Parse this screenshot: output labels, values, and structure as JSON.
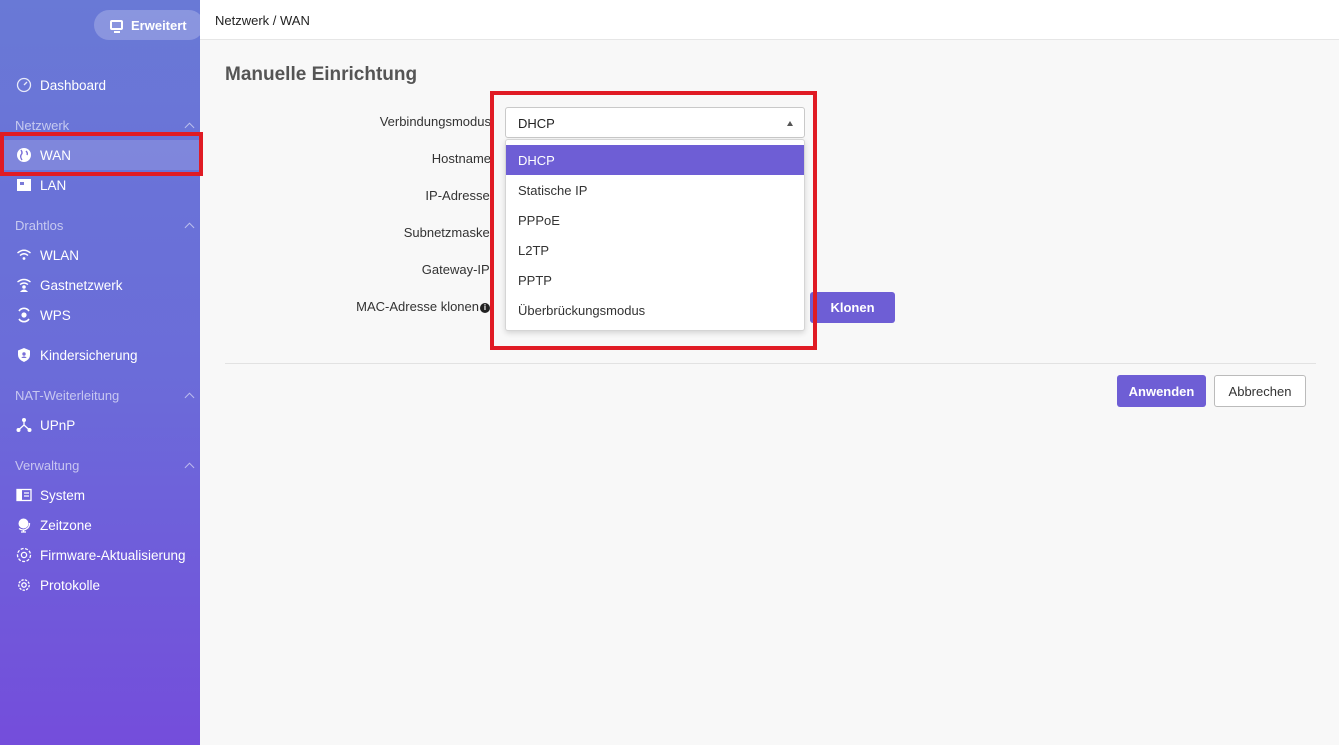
{
  "sidebar": {
    "mode_button": "Erweitert",
    "dashboard": "Dashboard",
    "sections": {
      "netzwerk": "Netzwerk",
      "drahtlos": "Drahtlos",
      "nat": "NAT-Weiterleitung",
      "verwaltung": "Verwaltung"
    },
    "items": {
      "wan": "WAN",
      "lan": "LAN",
      "wlan": "WLAN",
      "gastnetzwerk": "Gastnetzwerk",
      "wps": "WPS",
      "kindersicherung": "Kindersicherung",
      "upnp": "UPnP",
      "system": "System",
      "zeitzone": "Zeitzone",
      "firmware": "Firmware-Aktualisierung",
      "protokolle": "Protokolle"
    },
    "active_item": "WAN"
  },
  "header": {
    "breadcrumb": "Netzwerk / WAN"
  },
  "main": {
    "title": "Manuelle Einrichtung",
    "form": {
      "labels": {
        "verbindungsmodus": "Verbindungsmodus",
        "hostname": "Hostname",
        "ip": "IP-Adresse",
        "subnet": "Subnetzmaske",
        "gateway": "Gateway-IP",
        "mac": "MAC-Adresse klonen"
      },
      "required_mark": "*",
      "info_mark": "i",
      "mode_value": "DHCP",
      "mode_options": [
        "DHCP",
        "Statische IP",
        "PPPoE",
        "L2TP",
        "PPTP",
        "Überbrückungsmodus"
      ],
      "clone_button": "Klonen"
    },
    "actions": {
      "apply": "Anwenden",
      "cancel": "Abbrechen"
    }
  },
  "colors": {
    "accent": "#6e5ed5",
    "highlight": "#e01b24"
  }
}
